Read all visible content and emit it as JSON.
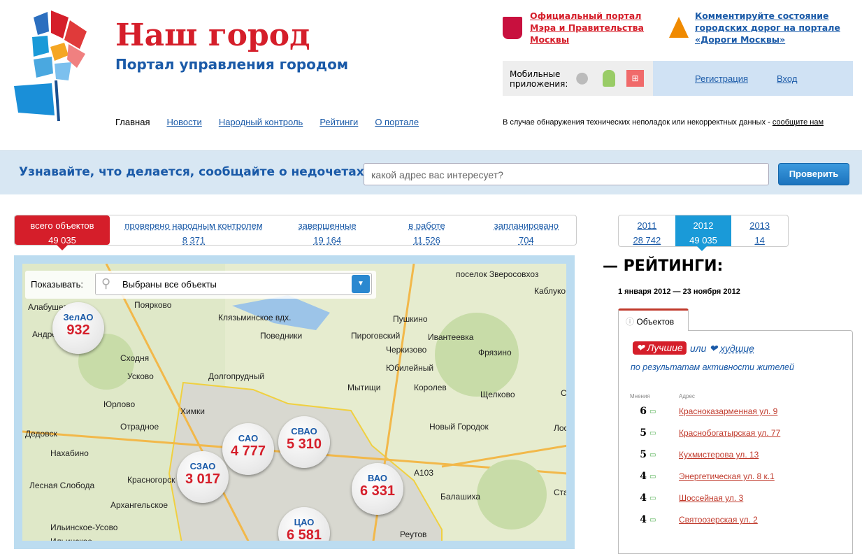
{
  "header": {
    "title": "Наш город",
    "subtitle": "Портал управления городом",
    "nav": [
      "Главная",
      "Новости",
      "Народный контроль",
      "Рейтинги",
      "О портале"
    ],
    "mayor_link": [
      "Официальный портал",
      "Мэра и Правительства",
      "Москвы"
    ],
    "roads_link": [
      "Комментируйте состояние",
      "городских дорог на портале",
      "«Дороги Москвы»"
    ],
    "mobile_label": [
      "Мобильные",
      "приложения:"
    ],
    "register": "Регистрация",
    "login": "Вход",
    "notice": "В случае обнаружения технических неполадок или некорректных данных - ",
    "notice_link": "сообщите нам"
  },
  "band": {
    "title": "Узнавайте, что делается, сообщайте о недочетах",
    "placeholder": "какой адрес вас интересует?",
    "button": "Проверить"
  },
  "stats": [
    {
      "label": "всего объектов",
      "value": "49 035"
    },
    {
      "label": "проверено народным контролем",
      "value": "8 371"
    },
    {
      "label": "завершенные",
      "value": "19 164"
    },
    {
      "label": "в работе",
      "value": "11 526"
    },
    {
      "label": "запланировано",
      "value": "704"
    }
  ],
  "years": [
    {
      "year": "2011",
      "value": "28 742"
    },
    {
      "year": "2012",
      "value": "49 035"
    },
    {
      "year": "2013",
      "value": "14"
    }
  ],
  "map": {
    "filter_label": "Показывать:",
    "filter_value": "Выбраны все объекты",
    "districts": [
      {
        "name": "ЗелАО",
        "count": "932"
      },
      {
        "name": "САО",
        "count": "4 777"
      },
      {
        "name": "СВАО",
        "count": "5 310"
      },
      {
        "name": "СЗАО",
        "count": "3 017"
      },
      {
        "name": "ВАО",
        "count": "6 331"
      },
      {
        "name": "ЦАО",
        "count": "6 581"
      }
    ],
    "towns": [
      "поселок Зверосовхоз",
      "Каблуко",
      "Поярково",
      "Алабушево",
      "Андреевка",
      "Сходня",
      "Усково",
      "Юрлово",
      "Отрадное",
      "Дедовск",
      "Нахабино",
      "Красногорск",
      "Архангельское",
      "Ильинское-Усово",
      "Ильинское",
      "Пушкино",
      "Ивантеевка",
      "Пироговский",
      "Черкизово",
      "Фрязино",
      "Юбилейный",
      "Королев",
      "Мытищи",
      "Щелково",
      "Долгопрудный",
      "Химки",
      "Новый Городок",
      "Балашиха",
      "Реутов",
      "Поведники",
      "Клязьминское вдх.",
      "Лось",
      "Свердл",
      "Стар",
      "Лесная Слобода",
      "А103"
    ]
  },
  "ratings": {
    "title": "РЕЙТИНГИ:",
    "period": "1 января 2012 — 23 ноября 2012",
    "tab": "Объектов",
    "best": "Лучшие",
    "or": "или",
    "worst": "худшие",
    "by": "по результатам активности жителей",
    "col_opinions": "Мнения",
    "col_address": "Адрес",
    "rows": [
      {
        "count": "6",
        "address": "Красноказарменная ул. 9"
      },
      {
        "count": "5",
        "address": "Краснобогатырская ул. 77"
      },
      {
        "count": "5",
        "address": "Кухмистерова ул. 13"
      },
      {
        "count": "4",
        "address": "Энергетическая ул. 8 к.1"
      },
      {
        "count": "4",
        "address": "Шоссейная ул. 3"
      },
      {
        "count": "4",
        "address": "Святоозерская ул. 2"
      }
    ]
  }
}
